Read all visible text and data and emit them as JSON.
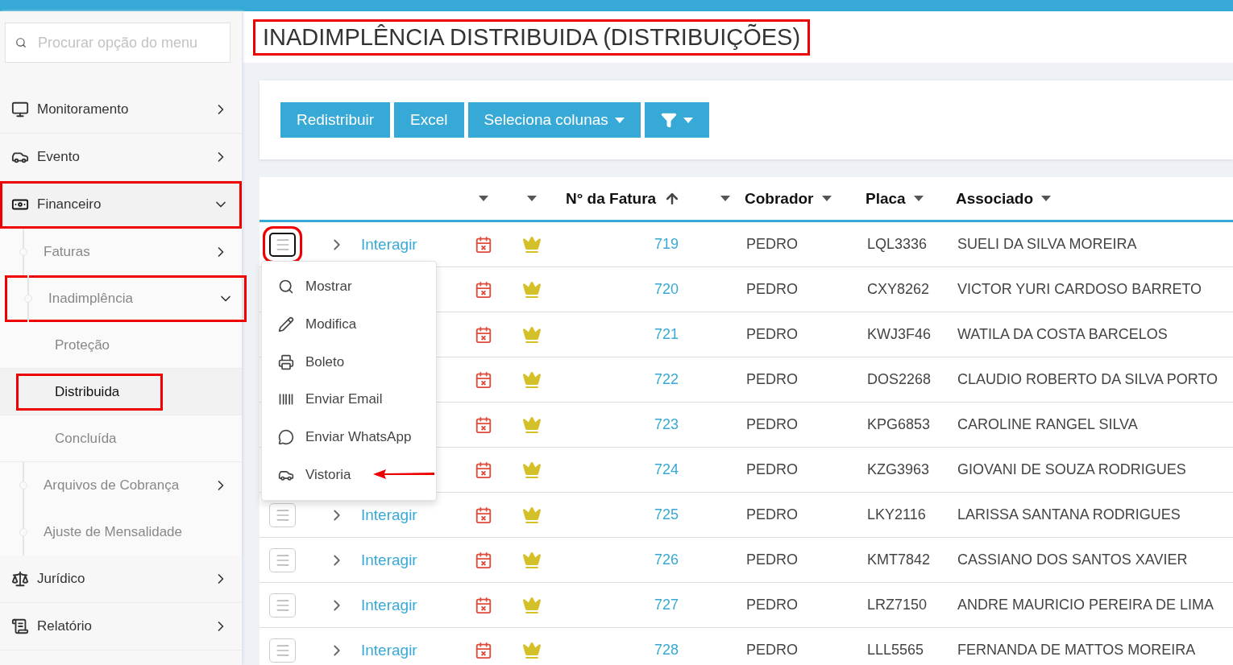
{
  "search": {
    "placeholder": "Procurar opção do menu"
  },
  "sidebar": {
    "items": [
      {
        "label": "Monitoramento",
        "expanded": false,
        "highlighted": false
      },
      {
        "label": "Evento",
        "expanded": false,
        "highlighted": false
      },
      {
        "label": "Financeiro",
        "expanded": true,
        "highlighted": true,
        "children": [
          {
            "label": "Faturas",
            "expanded": false,
            "highlighted": false
          },
          {
            "label": "Inadimplência",
            "expanded": true,
            "highlighted": true,
            "children": [
              {
                "label": "Proteção",
                "selected": false,
                "highlighted": false
              },
              {
                "label": "Distribuida",
                "selected": true,
                "highlighted": true
              },
              {
                "label": "Concluída",
                "selected": false,
                "highlighted": false
              }
            ]
          },
          {
            "label": "Arquivos de Cobrança",
            "expanded": false,
            "highlighted": false
          },
          {
            "label": "Ajuste de Mensalidade",
            "highlighted": false
          }
        ]
      },
      {
        "label": "Jurídico",
        "expanded": false,
        "highlighted": false
      },
      {
        "label": "Relatório",
        "expanded": false,
        "highlighted": false
      }
    ]
  },
  "page_title": {
    "text": "INADIMPLÊNCIA DISTRIBUIDA (DISTRIBUIÇÕES)",
    "highlighted": true
  },
  "toolbar": {
    "buttons": [
      {
        "label": "Redistribuir",
        "kind": "plain"
      },
      {
        "label": "Excel",
        "kind": "plain"
      },
      {
        "label": "Seleciona colunas",
        "kind": "dropdown"
      },
      {
        "kind": "filter"
      }
    ]
  },
  "table": {
    "columns": [
      "N° da Fatura",
      "Cobrador",
      "Placa",
      "Associado"
    ],
    "rows": [
      {
        "interagir": "Interagir",
        "menu_highlighted": true,
        "fatura": "719",
        "cobrador": "PEDRO",
        "placa": "LQL3336",
        "associado": "SUELI DA SILVA MOREIRA"
      },
      {
        "fatura": "720",
        "cobrador": "PEDRO",
        "placa": "CXY8262",
        "associado": "VICTOR YURI CARDOSO BARRETO"
      },
      {
        "fatura": "721",
        "cobrador": "PEDRO",
        "placa": "KWJ3F46",
        "associado": "WATILA DA COSTA BARCELOS"
      },
      {
        "fatura": "722",
        "cobrador": "PEDRO",
        "placa": "DOS2268",
        "associado": "CLAUDIO ROBERTO DA SILVA PORTO"
      },
      {
        "fatura": "723",
        "cobrador": "PEDRO",
        "placa": "KPG6853",
        "associado": "CAROLINE RANGEL SILVA"
      },
      {
        "fatura": "724",
        "cobrador": "PEDRO",
        "placa": "KZG3963",
        "associado": "GIOVANI DE SOUZA RODRIGUES"
      },
      {
        "interagir": "Interagir",
        "menu_highlighted": false,
        "fatura": "725",
        "cobrador": "PEDRO",
        "placa": "LKY2116",
        "associado": "LARISSA SANTANA RODRIGUES"
      },
      {
        "interagir": "Interagir",
        "menu_highlighted": false,
        "fatura": "726",
        "cobrador": "PEDRO",
        "placa": "KMT7842",
        "associado": "CASSIANO DOS SANTOS XAVIER"
      },
      {
        "interagir": "Interagir",
        "menu_highlighted": false,
        "fatura": "727",
        "cobrador": "PEDRO",
        "placa": "LRZ7150",
        "associado": "ANDRE MAURICIO PEREIRA DE LIMA"
      },
      {
        "interagir": "Interagir",
        "menu_highlighted": false,
        "fatura": "728",
        "cobrador": "PEDRO",
        "placa": "LLL5565",
        "associado": "FERNANDA DE MATTOS MOREIRA"
      }
    ]
  },
  "row_menu": {
    "items": [
      {
        "label": "Mostrar",
        "pointed": false
      },
      {
        "label": "Modifica",
        "pointed": false
      },
      {
        "label": "Boleto",
        "pointed": false
      },
      {
        "label": "Enviar Email",
        "pointed": false
      },
      {
        "label": "Enviar WhatsApp",
        "pointed": false
      },
      {
        "label": "Vistoria",
        "pointed": true
      }
    ]
  }
}
